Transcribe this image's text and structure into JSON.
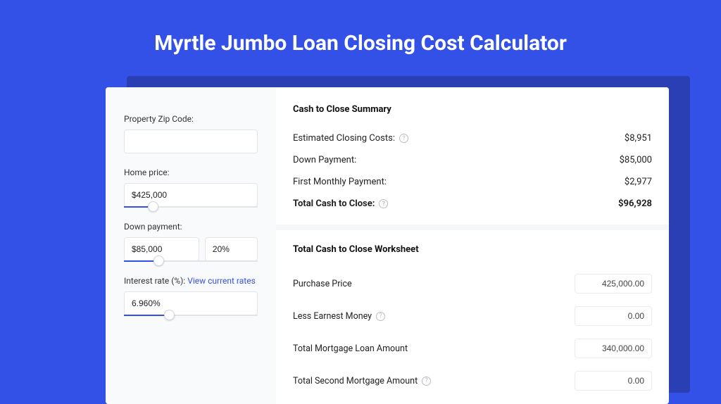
{
  "page_title": "Myrtle Jumbo Loan Closing Cost Calculator",
  "form": {
    "zip_label": "Property Zip Code:",
    "zip_value": "",
    "home_price_label": "Home price:",
    "home_price_value": "$425,000",
    "home_price_slider_pct": 18,
    "down_payment_label": "Down payment:",
    "down_payment_value": "$85,000",
    "down_payment_pct_value": "20%",
    "down_payment_slider_pct": 22,
    "interest_label": "Interest rate (%):",
    "interest_link": "View current rates",
    "interest_value": "6.960%",
    "interest_slider_pct": 30
  },
  "summary": {
    "title": "Cash to Close Summary",
    "rows": [
      {
        "label": "Estimated Closing Costs:",
        "has_help": true,
        "value": "$8,951",
        "bold": false
      },
      {
        "label": "Down Payment:",
        "has_help": false,
        "value": "$85,000",
        "bold": false
      },
      {
        "label": "First Monthly Payment:",
        "has_help": false,
        "value": "$2,977",
        "bold": false
      },
      {
        "label": "Total Cash to Close:",
        "has_help": true,
        "value": "$96,928",
        "bold": true
      }
    ]
  },
  "worksheet": {
    "title": "Total Cash to Close Worksheet",
    "rows": [
      {
        "label": "Purchase Price",
        "has_help": false,
        "value": "425,000.00"
      },
      {
        "label": "Less Earnest Money",
        "has_help": true,
        "value": "0.00"
      },
      {
        "label": "Total Mortgage Loan Amount",
        "has_help": false,
        "value": "340,000.00"
      },
      {
        "label": "Total Second Mortgage Amount",
        "has_help": true,
        "value": "0.00"
      }
    ]
  }
}
